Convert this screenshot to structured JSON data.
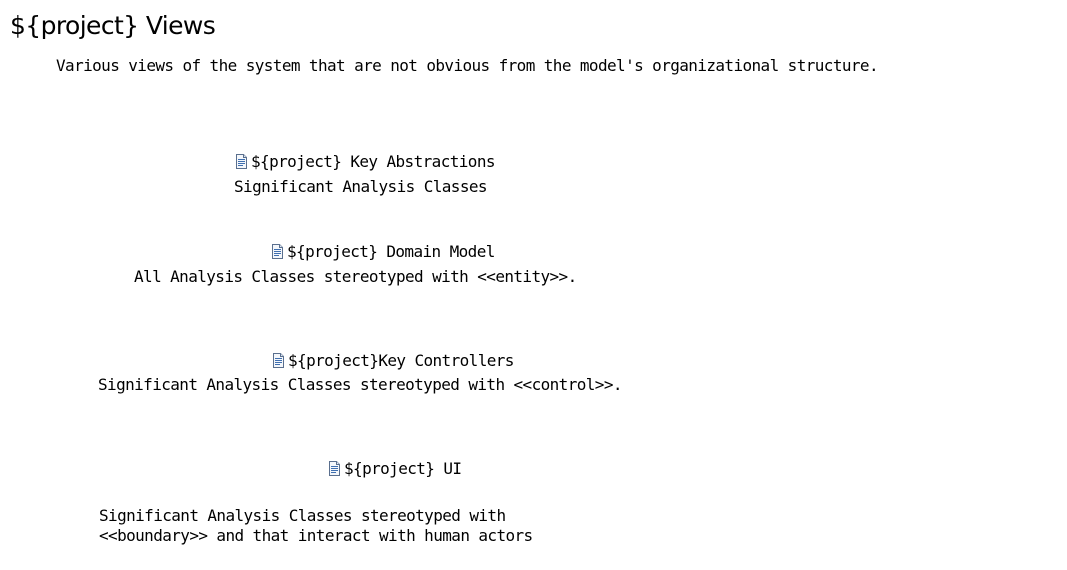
{
  "page": {
    "title": "${project} Views",
    "description": "Various views of the system that are not obvious from the model's organizational structure."
  },
  "diagrams": [
    {
      "icon": "diagram-document-icon",
      "label": "${project} Key Abstractions",
      "note_lines": [
        "Significant Analysis Classes"
      ]
    },
    {
      "icon": "diagram-document-icon",
      "label": "${project} Domain Model",
      "note_lines": [
        "All Analysis Classes stereotyped with <<entity>>."
      ]
    },
    {
      "icon": "diagram-document-icon",
      "label": "${project}Key Controllers",
      "note_lines": [
        "Significant Analysis Classes stereotyped with <<control>>."
      ]
    },
    {
      "icon": "diagram-document-icon",
      "label": "${project} UI",
      "note_lines": [
        "Significant Analysis Classes stereotyped with",
        "<<boundary>> and that interact with human actors"
      ]
    }
  ]
}
